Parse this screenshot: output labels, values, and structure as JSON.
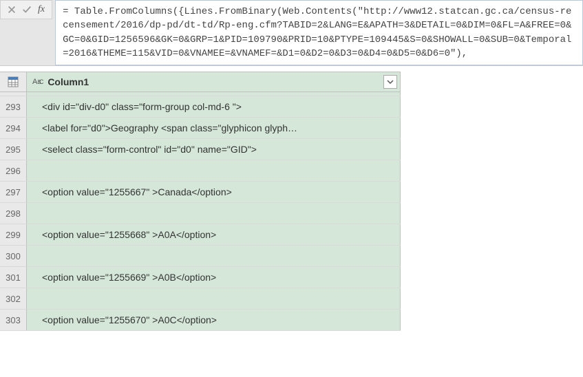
{
  "formula": {
    "text": "= Table.FromColumns({Lines.FromBinary(Web.Contents(\"http://www12.statcan.gc.ca/census-recensement/2016/dp-pd/dt-td/Rp-eng.cfm?TABID=2&LANG=E&APATH=3&DETAIL=0&DIM=0&FL=A&FREE=0&GC=0&GID=1256596&GK=0&GRP=1&PID=109790&PRID=10&PTYPE=109445&S=0&SHOWALL=0&SUB=0&Temporal=2016&THEME=115&VID=0&VNAMEE=&VNAMEF=&D1=0&D2=0&D3=0&D4=0&D5=0&D6=0\"),"
  },
  "column": {
    "name": "Column1",
    "type_label": "ABC"
  },
  "rows": [
    {
      "num": "293",
      "val": "            <div id=\"div-d0\" class=\"form-group col-md-6 \">"
    },
    {
      "num": "294",
      "val": "                <label for=\"d0\">Geography <span class=\"glyphicon glyph…"
    },
    {
      "num": "295",
      "val": "                <select class=\"form-control\" id=\"d0\" name=\"GID\">"
    },
    {
      "num": "296",
      "val": ""
    },
    {
      "num": "297",
      "val": "                  <option value=\"1255667\" >Canada</option>"
    },
    {
      "num": "298",
      "val": ""
    },
    {
      "num": "299",
      "val": "                  <option value=\"1255668\" >A0A</option>"
    },
    {
      "num": "300",
      "val": ""
    },
    {
      "num": "301",
      "val": "                  <option value=\"1255669\" >A0B</option>"
    },
    {
      "num": "302",
      "val": ""
    },
    {
      "num": "303",
      "val": "                  <option value=\"1255670\" >A0C</option>"
    }
  ]
}
